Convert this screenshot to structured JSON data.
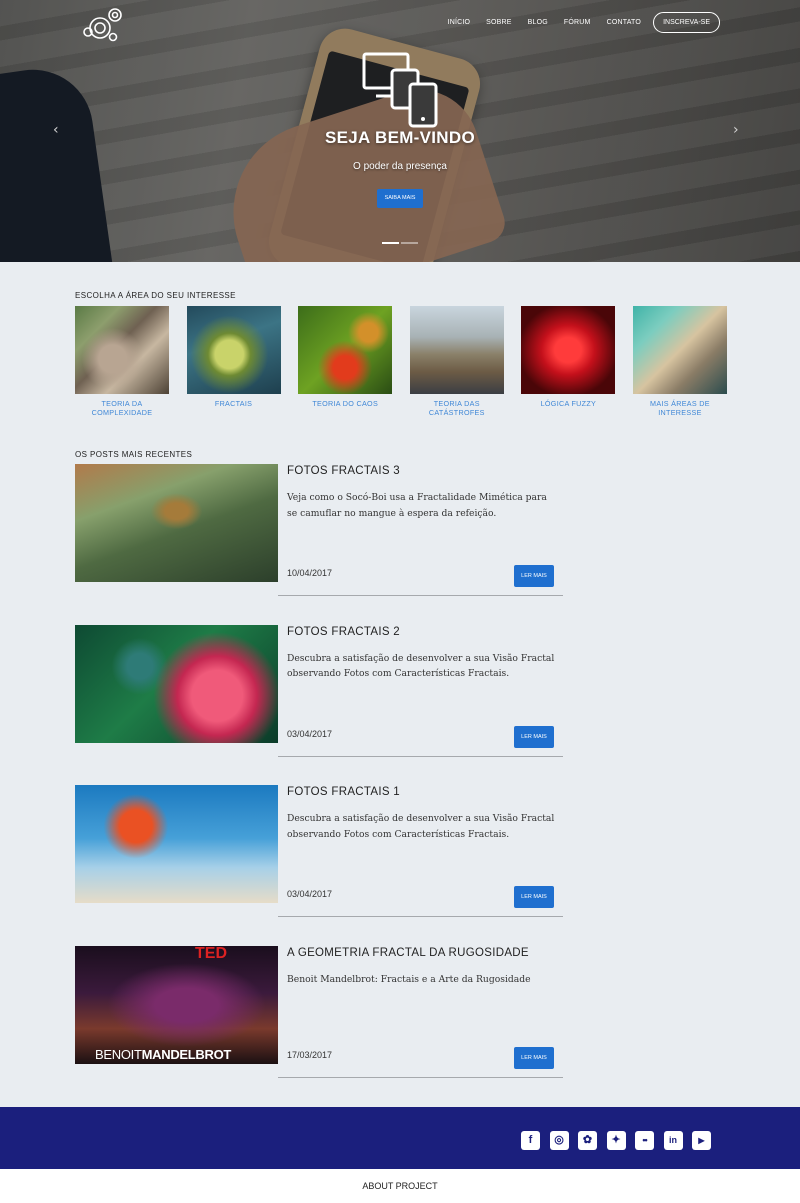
{
  "header": {
    "nav": [
      "Início",
      "Sobre",
      "Blog",
      "Fórum",
      "Contato"
    ],
    "cta": "Inscreva-se"
  },
  "hero": {
    "title": "SEJA BEM-VINDO",
    "subtitle": "O poder da presença",
    "button": "Saiba mais",
    "arrow_left": "‹",
    "arrow_right": "›",
    "slides": 2,
    "active_slide": 1
  },
  "areas": {
    "title": "Escolha a área do seu interesse",
    "items": [
      {
        "label": "Teoria da Complexidade"
      },
      {
        "label": "Fractais"
      },
      {
        "label": "Teoria do Caos"
      },
      {
        "label": "Teoria das Catástrofes"
      },
      {
        "label": "Lógica Fuzzy"
      },
      {
        "label": "Mais áreas de interesse"
      }
    ]
  },
  "posts": {
    "title": "Os posts mais recentes",
    "items": [
      {
        "title": "Fotos Fractais 3",
        "excerpt": "Veja como o Socó-Boi usa a Fractalidade Mimética para se camuflar no mangue à espera da refeição.",
        "date": "10/04/2017",
        "button": "Ler mais"
      },
      {
        "title": "Fotos Fractais 2",
        "excerpt": "Descubra a satisfação de desenvolver a sua Visão Fractal observando Fotos com Características Fractais.",
        "date": "03/04/2017",
        "button": "Ler mais"
      },
      {
        "title": "Fotos Fractais 1",
        "excerpt": "Descubra a satisfação de desenvolver a sua Visão Fractal observando Fotos com Características Fractais.",
        "date": "03/04/2017",
        "button": "Ler mais"
      },
      {
        "title": "A Geometria Fractal da Rugosidade",
        "excerpt": "Benoit Mandelbrot: Fractais e a Arte da Rugosidade",
        "date": "17/03/2017",
        "button": "Ler mais",
        "image_text": {
          "brand": "TED",
          "name_light": "BENOIT",
          "name_bold": "MANDELBROT"
        }
      }
    ]
  },
  "footer": {
    "social": [
      {
        "icon": "facebook-icon",
        "glyph": "f"
      },
      {
        "icon": "instagram-icon",
        "glyph": "◎"
      },
      {
        "icon": "snapchat-icon",
        "glyph": "✿"
      },
      {
        "icon": "twitter-icon",
        "glyph": "✦"
      },
      {
        "icon": "flickr-icon",
        "glyph": "••"
      },
      {
        "icon": "linkedin-icon",
        "glyph": "in"
      },
      {
        "icon": "youtube-icon",
        "glyph": "▶"
      }
    ],
    "about": "About Project"
  },
  "colors": {
    "accent": "#1f6fcf",
    "link": "#3f87d6",
    "footer": "#1b1f7d",
    "background": "#e9edf1"
  }
}
